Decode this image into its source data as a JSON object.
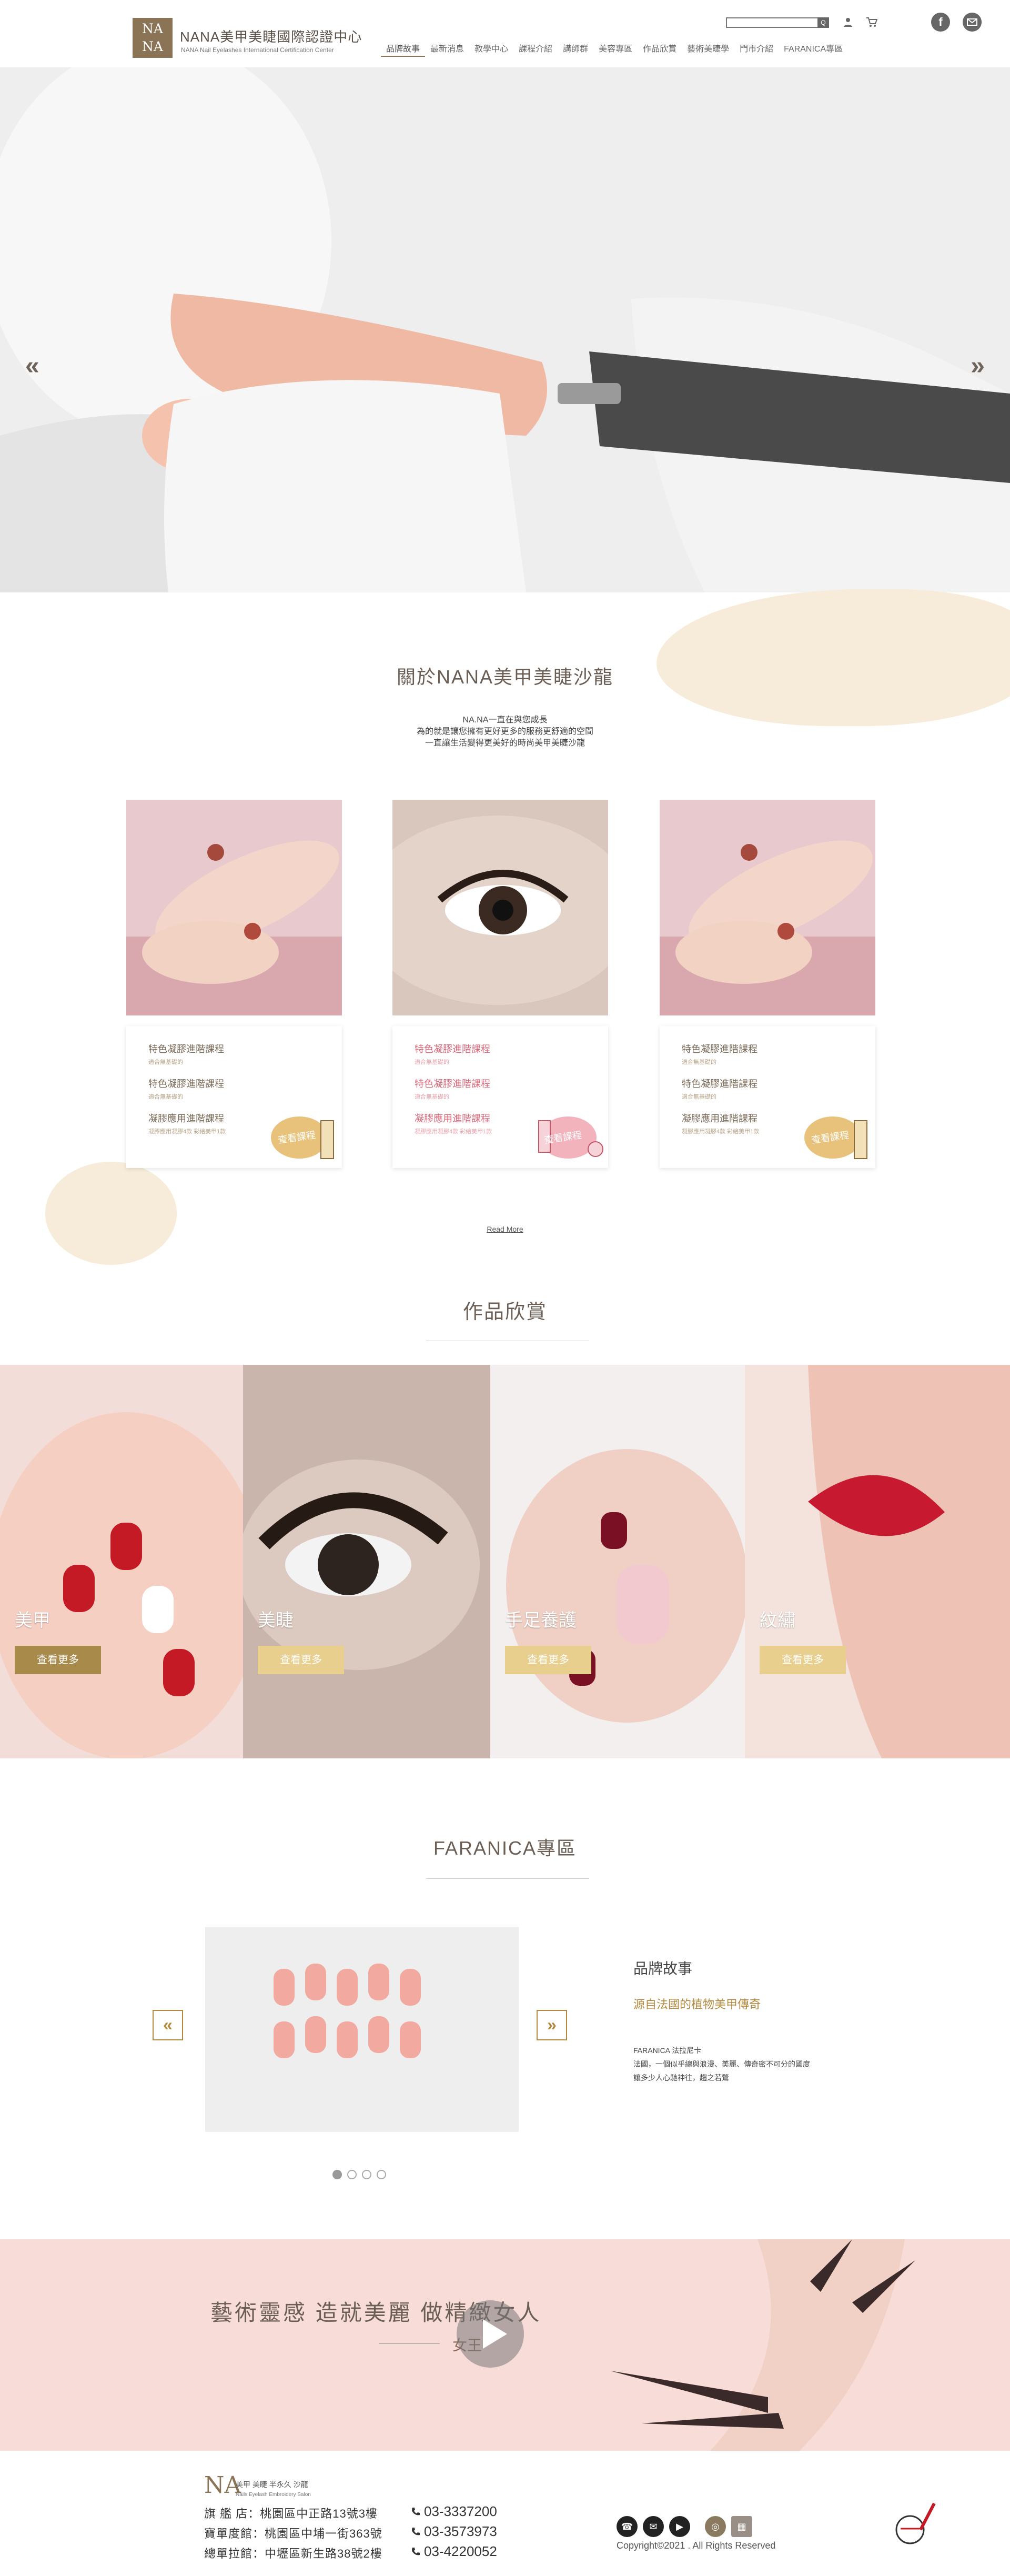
{
  "header": {
    "brand_title": "NANA美甲美睫國際認證中心",
    "brand_sub": "NANA Nail Eyelashes International Certification Center",
    "logo_text": "NA\nNA",
    "search": {
      "placeholder": "",
      "button": "Q"
    },
    "nav": [
      "品牌故事",
      "最新消息",
      "教學中心",
      "課程介紹",
      "講師群",
      "美容專區",
      "作品欣賞",
      "藝術美睫學",
      "門市介紹",
      "FARANICA專區"
    ]
  },
  "hero": {
    "prev": "«",
    "next": "»"
  },
  "about": {
    "title": "關於NANA美甲美睫沙龍",
    "lines": [
      "NA.NA一直在與您成長",
      "為的就是讓您擁有更好更多的服務更舒適的空間",
      "一直讓生活變得更美好的時尚美甲美睫沙龍"
    ]
  },
  "cards": [
    {
      "courses": [
        {
          "title": "特色凝膠進階課程",
          "sub": "適合無基礎的"
        },
        {
          "title": "特色凝膠進階課程",
          "sub": "適合無基礎的"
        },
        {
          "title": "凝膠應用進階課程",
          "sub": "凝膠應用凝膠4款 彩繪美甲1款"
        }
      ],
      "badge": "查看課程"
    },
    {
      "courses": [
        {
          "title": "特色凝膠進階課程",
          "sub": "適合無基礎的"
        },
        {
          "title": "特色凝膠進階課程",
          "sub": "適合無基礎的"
        },
        {
          "title": "凝膠應用進階課程",
          "sub": "凝膠應用凝膠4款 彩繪美甲1款"
        }
      ],
      "badge": "查看課程"
    },
    {
      "courses": [
        {
          "title": "特色凝膠進階課程",
          "sub": "適合無基礎的"
        },
        {
          "title": "特色凝膠進階課程",
          "sub": "適合無基礎的"
        },
        {
          "title": "凝膠應用進階課程",
          "sub": "凝膠應用凝膠4款 彩繪美甲1款"
        }
      ],
      "badge": "查看課程"
    }
  ],
  "read_more": "Read More",
  "works": {
    "title": "作品欣賞",
    "items": [
      {
        "label": "美甲",
        "button": "查看更多"
      },
      {
        "label": "美睫",
        "button": "查看更多"
      },
      {
        "label": "手足養護",
        "button": "查看更多"
      },
      {
        "label": "紋繡",
        "button": "查看更多"
      }
    ]
  },
  "faranica": {
    "title": "FARANICA專區",
    "prev": "«",
    "next": "»",
    "story_title": "品牌故事",
    "story_sub": "源自法國的植物美甲傳奇",
    "story_lines": [
      "FARANICA 法拉尼卡",
      "法國，一個似乎總與浪漫、美麗、傳奇密不可分的國度",
      "讓多少人心馳神往，趨之若鶩"
    ]
  },
  "banner": {
    "text": "藝術靈感  造就美麗  做精緻女人",
    "script": "女王"
  },
  "footer": {
    "logo": "NA",
    "logo_sub": "美甲 美睫 半永久 沙龍",
    "logo_sub2": "Nails Eyelash Embroidery Salon",
    "stores": [
      "旗 艦 店：桃園區中正路13號3樓",
      "寶單度館：桃園區中埔一街363號",
      "總單拉館：中壢區新生路38號2樓"
    ],
    "phones": [
      "03-3337200",
      "03-3573973",
      "03-4220052"
    ],
    "copyright": "Copyright©2021 . All Rights Reserved"
  },
  "colors": {
    "brand": "#8b7356",
    "gold": "#b38a40",
    "pink": "#d9687a",
    "cream": "#f7ecd9"
  }
}
